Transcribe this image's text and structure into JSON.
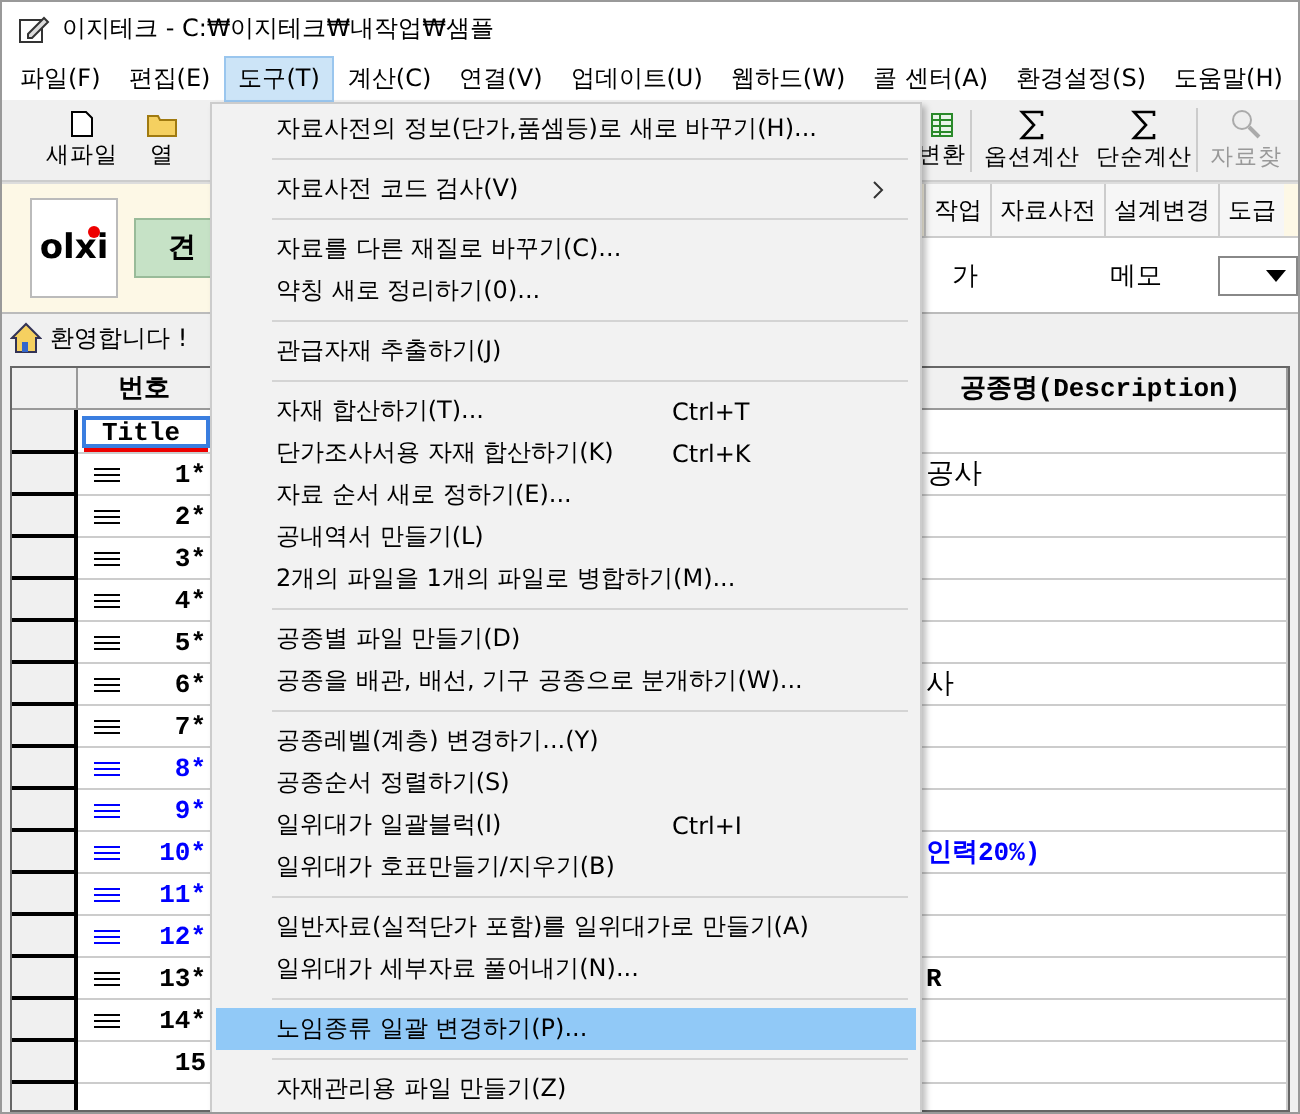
{
  "window": {
    "title": "이지테크 - C:₩이지테크₩내작업₩샘플"
  },
  "menubar": [
    {
      "label": "파일(F)",
      "selected": false
    },
    {
      "label": "편집(E)",
      "selected": false
    },
    {
      "label": "도구(T)",
      "selected": true
    },
    {
      "label": "계산(C)",
      "selected": false
    },
    {
      "label": "연결(V)",
      "selected": false
    },
    {
      "label": "업데이트(U)",
      "selected": false
    },
    {
      "label": "웹하드(W)",
      "selected": false
    },
    {
      "label": "콜 센터(A)",
      "selected": false
    },
    {
      "label": "환경설정(S)",
      "selected": false
    },
    {
      "label": "도움말(H)",
      "selected": false
    }
  ],
  "toolbar_left": [
    {
      "label": "새파일",
      "kind": "file",
      "disabled": false
    },
    {
      "label": "열",
      "kind": "folder",
      "disabled": false
    }
  ],
  "toolbar_right": [
    {
      "label": "변환",
      "kind": "sheet",
      "disabled": false
    },
    {
      "label": "옵션계산",
      "kind": "sigma",
      "disabled": false
    },
    {
      "label": "단순계산",
      "kind": "sigma",
      "disabled": false
    },
    {
      "label": "자료찾",
      "kind": "magnifier",
      "disabled": true
    }
  ],
  "panel": {
    "logo": "olxi",
    "green_button": "견",
    "tabs": [
      "작업",
      "자료사전",
      "설계변경",
      "도급"
    ],
    "field_label": "가",
    "memo_label": "메모"
  },
  "welcome": "환영합니다 !",
  "grid": {
    "columns": [
      "번호",
      "공종명(Description)"
    ],
    "title_cell": "Title",
    "rows": [
      {
        "number": "1*",
        "marker": true,
        "color": "#000000",
        "description": "공사",
        "bold": false
      },
      {
        "number": "2*",
        "marker": true,
        "color": "#000000"
      },
      {
        "number": "3*",
        "marker": true,
        "color": "#000000"
      },
      {
        "number": "4*",
        "marker": true,
        "color": "#000000"
      },
      {
        "number": "5*",
        "marker": true,
        "color": "#000000"
      },
      {
        "number": "6*",
        "marker": true,
        "color": "#000000",
        "description": "사",
        "bold": false
      },
      {
        "number": "7*",
        "marker": true,
        "color": "#000000"
      },
      {
        "number": "8*",
        "marker": true,
        "color": "#0000ff"
      },
      {
        "number": "9*",
        "marker": true,
        "color": "#0000ff"
      },
      {
        "number": "10*",
        "marker": true,
        "color": "#0000ff",
        "description": "인력20%)",
        "bold": true
      },
      {
        "number": "11*",
        "marker": true,
        "color": "#0000ff"
      },
      {
        "number": "12*",
        "marker": true,
        "color": "#0000ff"
      },
      {
        "number": "13*",
        "marker": true,
        "color": "#000000",
        "description": "R",
        "bold": true
      },
      {
        "number": "14*",
        "marker": true,
        "color": "#000000"
      },
      {
        "number": "15",
        "marker": false,
        "color": "#000000"
      }
    ]
  },
  "menu": [
    {
      "kind": "item",
      "label": "자료사전의 정보(단가,품셈등)로 새로 바꾸기(H)...",
      "submenu": false,
      "selected": false
    },
    {
      "kind": "separator"
    },
    {
      "kind": "item",
      "label": "자료사전 코드 검사(V)",
      "submenu": true,
      "selected": false
    },
    {
      "kind": "separator"
    },
    {
      "kind": "item",
      "label": "자료를 다른 재질로 바꾸기(C)...",
      "submenu": false,
      "selected": false
    },
    {
      "kind": "item",
      "label": "약칭 새로 정리하기(0)...",
      "submenu": false,
      "selected": false
    },
    {
      "kind": "separator"
    },
    {
      "kind": "item",
      "label": "관급자재 추출하기(J)",
      "submenu": false,
      "selected": false
    },
    {
      "kind": "separator"
    },
    {
      "kind": "item",
      "label": "자재 합산하기(T)...",
      "shortcut": "Ctrl+T",
      "submenu": false,
      "selected": false
    },
    {
      "kind": "item",
      "label": "단가조사서용 자재 합산하기(K)",
      "shortcut": "Ctrl+K",
      "submenu": false,
      "selected": false
    },
    {
      "kind": "item",
      "label": "자료 순서 새로 정하기(E)...",
      "submenu": false,
      "selected": false
    },
    {
      "kind": "item",
      "label": "공내역서 만들기(L)",
      "submenu": false,
      "selected": false
    },
    {
      "kind": "item",
      "label": "2개의 파일을 1개의 파일로 병합하기(M)...",
      "submenu": false,
      "selected": false
    },
    {
      "kind": "separator"
    },
    {
      "kind": "item",
      "label": "공종별 파일 만들기(D)",
      "submenu": false,
      "selected": false
    },
    {
      "kind": "item",
      "label": "공종을 배관, 배선, 기구 공종으로 분개하기(W)...",
      "submenu": false,
      "selected": false
    },
    {
      "kind": "separator"
    },
    {
      "kind": "item",
      "label": "공종레벨(계층) 변경하기...(Y)",
      "submenu": false,
      "selected": false
    },
    {
      "kind": "item",
      "label": "공종순서 정렬하기(S)",
      "submenu": false,
      "selected": false
    },
    {
      "kind": "item",
      "label": "일위대가 일괄블럭(I)",
      "shortcut": "Ctrl+I",
      "submenu": false,
      "selected": false
    },
    {
      "kind": "item",
      "label": "일위대가 호표만들기/지우기(B)",
      "submenu": false,
      "selected": false
    },
    {
      "kind": "separator"
    },
    {
      "kind": "item",
      "label": "일반자료(실적단가 포함)를 일위대가로 만들기(A)",
      "submenu": false,
      "selected": false
    },
    {
      "kind": "item",
      "label": "일위대가 세부자료 풀어내기(N)...",
      "submenu": false,
      "selected": false
    },
    {
      "kind": "separator"
    },
    {
      "kind": "item",
      "label": "노임종류 일괄 변경하기(P)...",
      "submenu": false,
      "selected": true
    },
    {
      "kind": "separator"
    },
    {
      "kind": "item",
      "label": "자재관리용 파일 만들기(Z)",
      "submenu": false,
      "selected": false
    }
  ]
}
